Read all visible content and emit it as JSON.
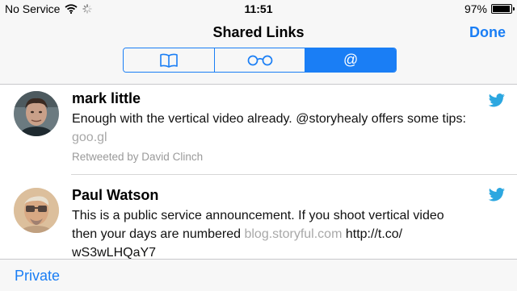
{
  "status_bar": {
    "carrier": "No Service",
    "time": "11:51",
    "battery_percent": "97%",
    "battery_level": 0.97,
    "icons": [
      "wifi-icon",
      "loading-spinner-icon",
      "battery-icon"
    ]
  },
  "nav": {
    "title": "Shared Links",
    "done_label": "Done",
    "segments": [
      {
        "name": "bookmarks",
        "icon": "book-icon"
      },
      {
        "name": "reading-list",
        "icon": "glasses-icon"
      },
      {
        "name": "shared-links",
        "label": "@",
        "active": true
      }
    ]
  },
  "tweets": [
    {
      "author": "mark little",
      "text": "Enough with the vertical video already. @storyhealy offers some tips:",
      "link": "goo.gl",
      "retweeted_by": "Retweeted by David Clinch",
      "icon": "twitter-bird-icon"
    },
    {
      "author": "Paul Watson",
      "text_lines": [
        "This is a public service announcement. If you shoot vertical video",
        "then your days are numbered"
      ],
      "link": "blog.storyful.com",
      "url_tail": "http://t.co/",
      "url_end": "wS3wLHQaY7",
      "icon": "twitter-bird-icon"
    }
  ],
  "bottom_bar": {
    "private_label": "Private"
  },
  "colors": {
    "accent": "#1a7ef5",
    "bar_background": "#f7f7f7",
    "twitter_blue": "#2ca7e0",
    "muted_link": "#a8a8a8"
  }
}
